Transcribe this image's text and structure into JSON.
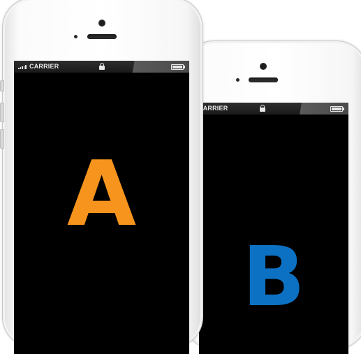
{
  "phones": {
    "a": {
      "carrier": "CARRIER",
      "letter": "A",
      "letter_color": "#F7941D"
    },
    "b": {
      "carrier": "CARRIER",
      "letter": "B",
      "letter_color": "#0C71C3"
    }
  },
  "colors": {
    "screen": "#000000",
    "bezel": "#FFFFFF"
  },
  "icons": {
    "signal": "signal-bars-icon",
    "lock": "lock-icon",
    "battery": "battery-icon"
  }
}
